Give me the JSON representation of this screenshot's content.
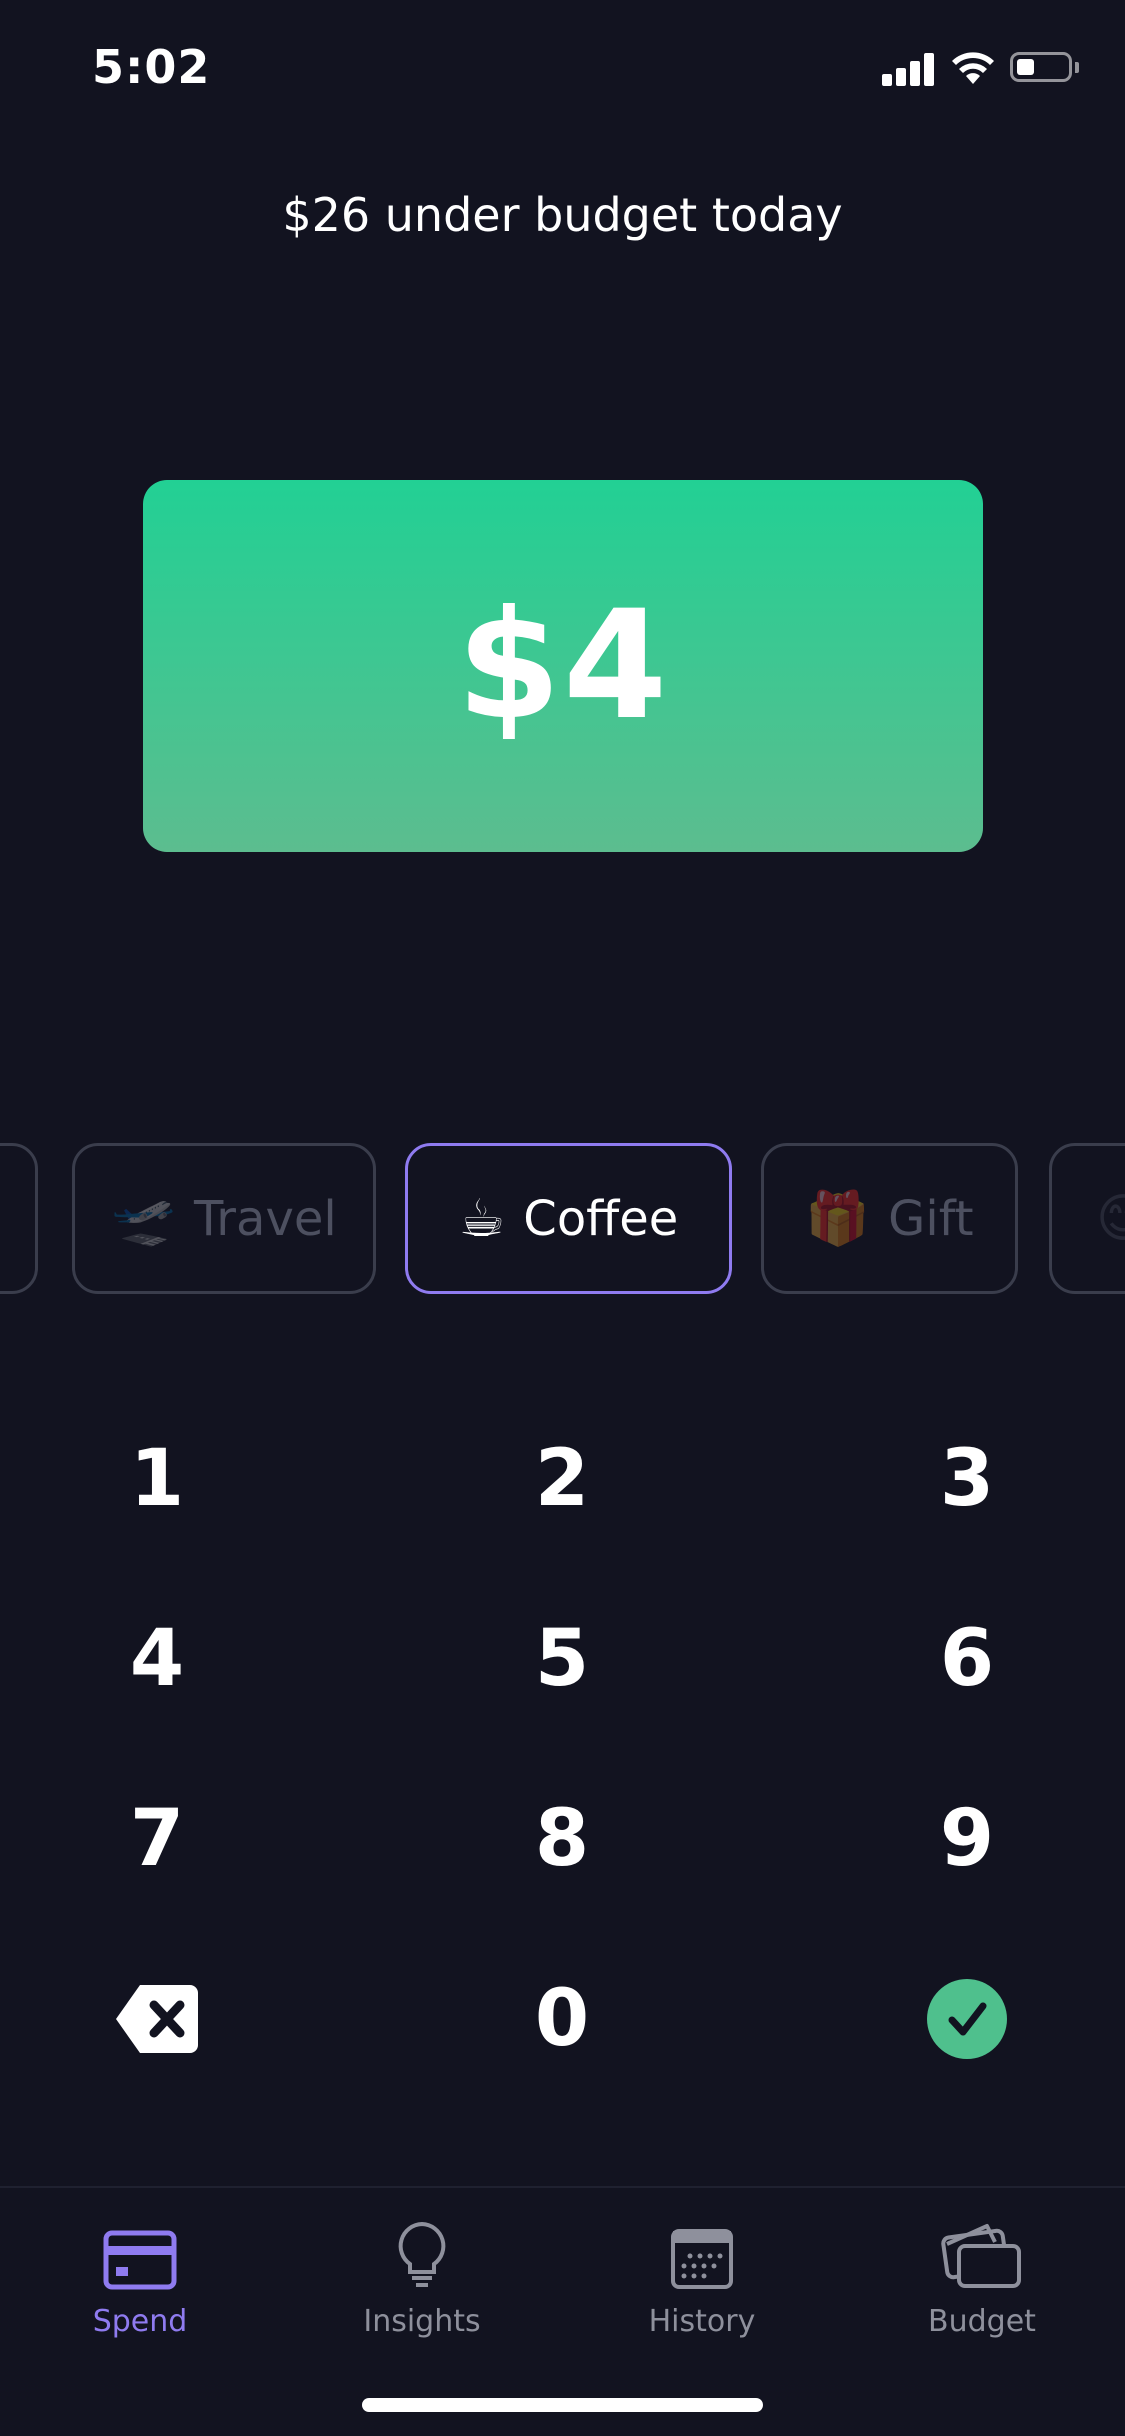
{
  "status_bar": {
    "time": "5:02"
  },
  "header": {
    "budget_message": "$26 under budget today"
  },
  "amount": {
    "value": "$4"
  },
  "categories": [
    {
      "emoji": "",
      "label": "",
      "active": false
    },
    {
      "emoji": "🛫",
      "label": "Travel",
      "active": false
    },
    {
      "emoji": "☕",
      "label": "Coffee",
      "active": true
    },
    {
      "emoji": "🎁",
      "label": "Gift",
      "active": false
    },
    {
      "emoji": "😊",
      "label": "",
      "active": false
    }
  ],
  "keypad": {
    "keys": [
      "1",
      "2",
      "3",
      "4",
      "5",
      "6",
      "7",
      "8",
      "9",
      "0"
    ],
    "backspace_icon": "backspace-icon",
    "confirm_icon": "checkmark-icon"
  },
  "tab_bar": {
    "tabs": [
      {
        "label": "Spend",
        "icon": "card-icon",
        "active": true
      },
      {
        "label": "Insights",
        "icon": "lightbulb-icon",
        "active": false
      },
      {
        "label": "History",
        "icon": "calendar-icon",
        "active": false
      },
      {
        "label": "Budget",
        "icon": "wallet-icon",
        "active": false
      }
    ]
  },
  "colors": {
    "background": "#121320",
    "accent": "#8f7bf0",
    "amount_card_top": "#22d094",
    "amount_card_bottom": "#5cbd8f",
    "confirm": "#4fc08d",
    "inactive": "#8e909c"
  }
}
